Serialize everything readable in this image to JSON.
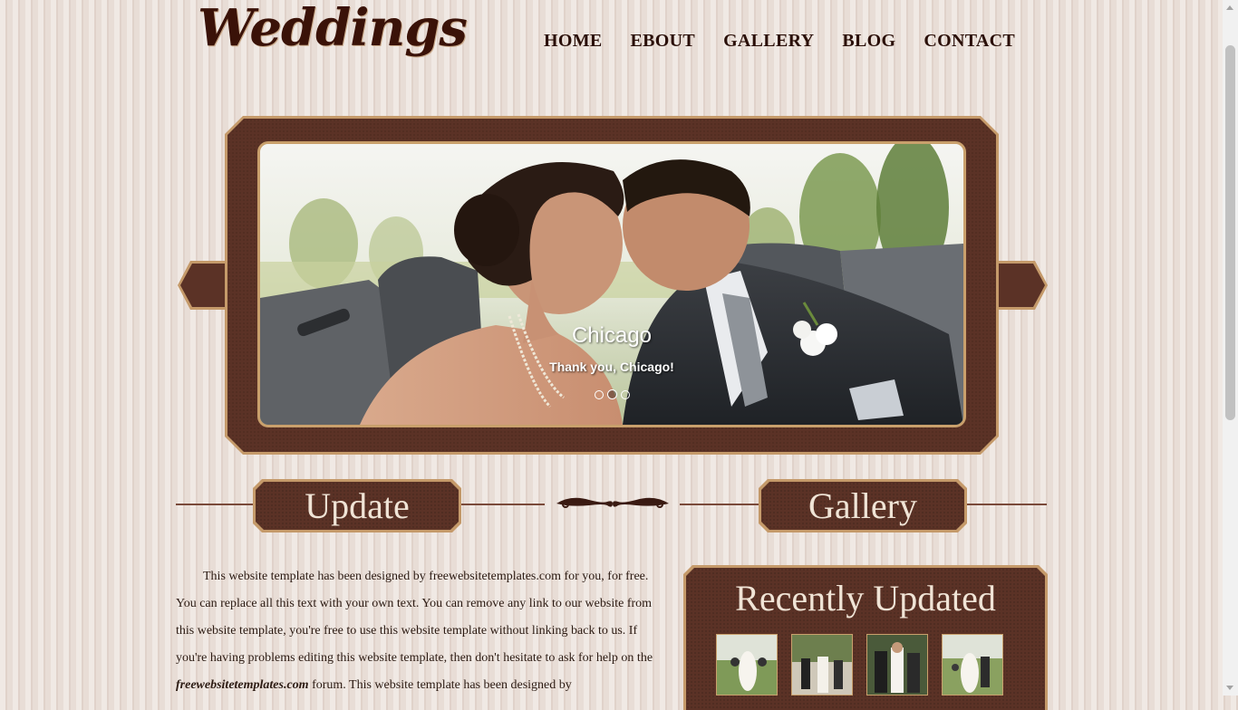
{
  "header": {
    "logo": "Weddings"
  },
  "nav": {
    "items": [
      {
        "label": "HOME"
      },
      {
        "label": "EBOUT"
      },
      {
        "label": "GALLERY"
      },
      {
        "label": "BLOG"
      },
      {
        "label": "CONTACT"
      }
    ]
  },
  "slider": {
    "title": "Chicago",
    "subtitle": "Thank you, Chicago!",
    "slide_count": 3,
    "active_slide": 2
  },
  "sections": {
    "update_label": "Update",
    "gallery_label": "Gallery"
  },
  "content": {
    "paragraph_1": "This website template has been designed by freewebsitetemplates.com for you, for free. You can replace all this text with your own text. You can remove any link to our website from this website template, you're free to use this website template without linking back to us. If you're having problems editing this website template, then don't hesitate to ask for help on the",
    "forum_link": "freewebsitetemplates.com",
    "paragraph_2": " forum. This website template has been designed by"
  },
  "recent": {
    "title": "Recently Updated",
    "thumbs": [
      {
        "name": "thumb-1"
      },
      {
        "name": "thumb-2"
      },
      {
        "name": "thumb-3"
      },
      {
        "name": "thumb-4"
      }
    ]
  },
  "colors": {
    "brand": "#5b3226",
    "accent": "#c59a6a",
    "background": "#e8ddd6",
    "logo": "#3a1208"
  }
}
